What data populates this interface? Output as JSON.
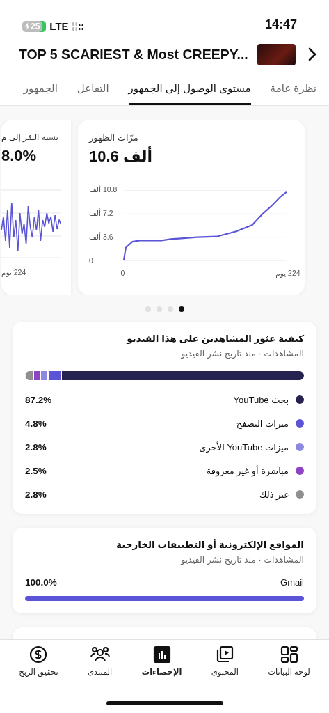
{
  "status_bar": {
    "battery": "25",
    "network": "LTE",
    "time": "14:47"
  },
  "header": {
    "title": "TOP 5 SCARIEST & Most CREEPY..."
  },
  "tabs": [
    {
      "label": "نظرة عامة",
      "selected": false
    },
    {
      "label": "مستوى الوصول إلى الجمهور",
      "selected": true
    },
    {
      "label": "التفاعل",
      "selected": false
    },
    {
      "label": "الجمهور",
      "selected": false
    }
  ],
  "metric_cards": [
    {
      "kind": "chart",
      "title": "مرّات الظهور",
      "value": "10.6 ألف",
      "chart_data": {
        "type": "line",
        "xlim": [
          0,
          224
        ],
        "ylim": [
          0,
          10.8
        ],
        "yticks": [
          {
            "value": 0,
            "label": "0"
          },
          {
            "value": 3.6,
            "label": "3.6 ألف"
          },
          {
            "value": 7.2,
            "label": "7.2 ألف"
          },
          {
            "value": 10.8,
            "label": "10.8 ألف"
          }
        ],
        "xticks": [
          {
            "value": 0,
            "label": "0"
          },
          {
            "value": 224,
            "label": "224 يوم"
          }
        ],
        "x": [
          0,
          3,
          12,
          22,
          52,
          65,
          101,
          128,
          155,
          177,
          191,
          204,
          216,
          224
        ],
        "series": [
          {
            "color": "#5b54d6",
            "values": [
              0,
              2.0,
              2.9,
              3.1,
              3.1,
              3.3,
              3.6,
              3.7,
              4.5,
              5.5,
              7.2,
              8.5,
              9.9,
              10.6
            ]
          }
        ]
      }
    },
    {
      "kind": "sparkline",
      "title": "نسبة النقر إلى م",
      "value": "8.0%",
      "x_end": "224 يوم"
    }
  ],
  "carousel_dots": [
    {
      "selected": true
    },
    {
      "selected": false
    },
    {
      "selected": false
    },
    {
      "selected": false
    }
  ],
  "traffic_sources": {
    "title": "كيفية عثور المشاهدين على هذا الفيديو",
    "subtitle": "المشاهدات · منذ تاريخ نشر الفيديو",
    "items": [
      {
        "label": "بحث YouTube",
        "value": "87.2%",
        "level": 0.872,
        "color": "#25224f"
      },
      {
        "label": "ميزات التصفح",
        "value": "4.8%",
        "level": 0.048,
        "color": "#5b54d6"
      },
      {
        "label": "ميزات YouTube الأخرى",
        "value": "2.8%",
        "level": 0.028,
        "color": "#8d89e0"
      },
      {
        "label": "مباشرة أو غير معروفة",
        "value": "2.5%",
        "level": 0.025,
        "color": "#8e44c4"
      },
      {
        "label": "غير ذلك",
        "value": "2.8%",
        "level": 0.028,
        "color": "#8f8f8f"
      }
    ]
  },
  "external_sources": {
    "title": "المواقع الإلكترونية أو التطبيقات الخارجية",
    "subtitle": "المشاهدات · منذ تاريخ نشر الفيديو",
    "items": [
      {
        "label": "Gmail",
        "value": "100.0%",
        "level": 1.0
      }
    ]
  },
  "bottom_nav": [
    {
      "kind": "dashboard",
      "label": "لوحة البيانات",
      "selected": false
    },
    {
      "kind": "content",
      "label": "المحتوى",
      "selected": false
    },
    {
      "kind": "analytics",
      "label": "الإحصاءات",
      "selected": true
    },
    {
      "kind": "community",
      "label": "المنتدى",
      "selected": false
    },
    {
      "kind": "earn",
      "label": "تحقيق الربح",
      "selected": false
    }
  ]
}
